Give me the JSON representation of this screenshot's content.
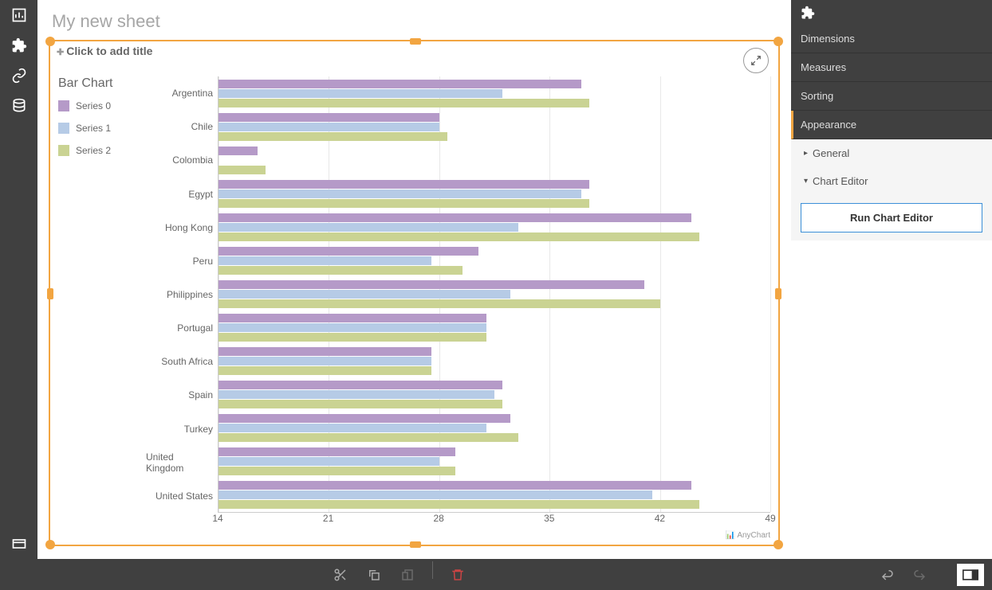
{
  "sheet": {
    "title": "My new sheet",
    "chart_title_placeholder": "Click to add title"
  },
  "chart": {
    "title": "Bar Chart",
    "legend": [
      "Series 0",
      "Series 1",
      "Series 2"
    ],
    "colors": [
      "#b59ac8",
      "#b6cbe6",
      "#cad393"
    ],
    "credit": "AnyChart"
  },
  "panel": {
    "sections": {
      "dimensions": "Dimensions",
      "measures": "Measures",
      "sorting": "Sorting",
      "appearance": "Appearance"
    },
    "sub": {
      "general": "General",
      "chart_editor": "Chart Editor"
    },
    "run_button": "Run Chart Editor"
  },
  "chart_data": {
    "type": "bar",
    "title": "Bar Chart",
    "orientation": "horizontal",
    "xlabel": "",
    "ylabel": "",
    "xlim": [
      14,
      49
    ],
    "x_ticks": [
      14,
      21,
      28,
      35,
      42,
      49
    ],
    "categories": [
      "Argentina",
      "Chile",
      "Colombia",
      "Egypt",
      "Hong Kong",
      "Peru",
      "Philippines",
      "Portugal",
      "South Africa",
      "Spain",
      "Turkey",
      "United Kingdom",
      "United States"
    ],
    "series": [
      {
        "name": "Series 0",
        "color": "#b59ac8",
        "values": [
          37,
          28,
          16.5,
          37.5,
          44,
          30.5,
          41,
          31,
          27.5,
          32,
          32.5,
          29,
          44
        ]
      },
      {
        "name": "Series 1",
        "color": "#b6cbe6",
        "values": [
          32,
          28,
          14,
          37,
          33,
          27.5,
          32.5,
          31,
          27.5,
          31.5,
          31,
          28,
          41.5
        ]
      },
      {
        "name": "Series 2",
        "color": "#cad393",
        "values": [
          37.5,
          28.5,
          17,
          37.5,
          44.5,
          29.5,
          42,
          31,
          27.5,
          32,
          33,
          29,
          44.5
        ]
      }
    ]
  }
}
